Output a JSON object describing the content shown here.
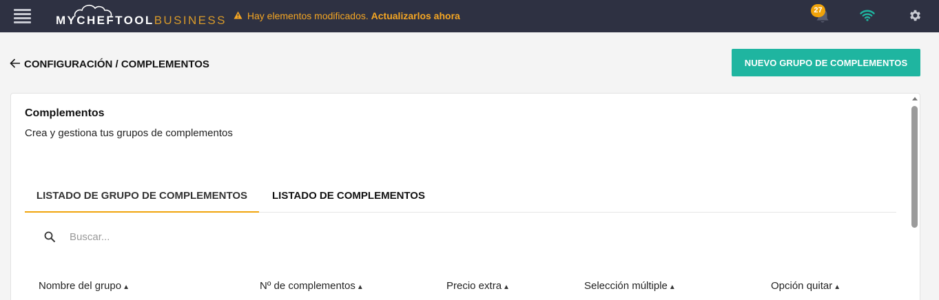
{
  "topbar": {
    "logo_part1": "MYCHEFTOOL",
    "logo_part2": "BUSINESS",
    "alert_text": "Hay elementos modificados.",
    "alert_link": "Actualizarlos ahora",
    "notification_count": "27"
  },
  "header": {
    "breadcrumb": "CONFIGURACIÓN / COMPLEMENTOS",
    "new_group_button": "NUEVO GRUPO DE COMPLEMENTOS"
  },
  "card": {
    "title": "Complementos",
    "subtitle": "Crea y gestiona tus grupos de complementos",
    "tabs": [
      {
        "label": "LISTADO DE GRUPO DE COMPLEMENTOS",
        "active": true
      },
      {
        "label": "LISTADO DE COMPLEMENTOS",
        "active": false
      }
    ],
    "search": {
      "placeholder": "Buscar...",
      "value": ""
    },
    "columns": [
      "Nombre del grupo",
      "Nº de complementos",
      "Precio extra",
      "Selección múltiple",
      "Opción quitar"
    ]
  },
  "colors": {
    "topbar_bg": "#2e3142",
    "accent_orange": "#f0a30a",
    "button_teal": "#1fb5a0",
    "wifi_green": "#1fb5a0"
  },
  "icons": [
    "hamburger-icon",
    "cloud-logo-icon",
    "warning-icon",
    "bell-icon",
    "wifi-icon",
    "gear-icon",
    "back-arrow-icon",
    "search-icon",
    "sort-caret-icon"
  ]
}
